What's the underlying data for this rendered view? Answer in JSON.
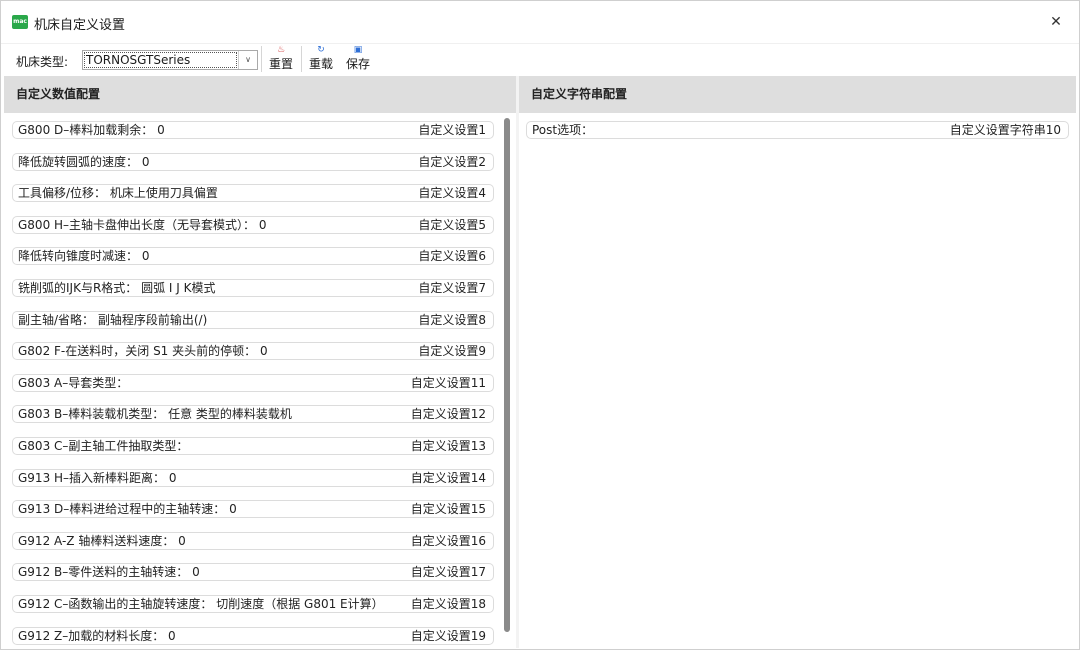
{
  "window": {
    "icon_text": "mac",
    "title": "机床自定义设置",
    "close_symbol": "✕"
  },
  "toolbar": {
    "machine_type_label": "机床类型:",
    "machine_type_value": "TORNOSGTSeries",
    "dropdown_arrow": "∨",
    "reset_label": "重置",
    "reset_icon": "♨",
    "reload_label": "重载",
    "reload_icon": "↻",
    "save_label": "保存",
    "save_icon": "▣"
  },
  "numeric_panel": {
    "header": "自定义数值配置",
    "rows": [
      {
        "label": "G800 D–棒料加载剩余：  0",
        "setting": "自定义设置1"
      },
      {
        "label": "降低旋转圆弧的速度：  0",
        "setting": "自定义设置2"
      },
      {
        "label": "工具偏移/位移：  机床上使用刀具偏置",
        "setting": "自定义设置4"
      },
      {
        "label": "G800 H–主轴卡盘伸出长度（无导套模式）：  0",
        "setting": "自定义设置5"
      },
      {
        "label": "降低转向锥度时减速：  0",
        "setting": "自定义设置6"
      },
      {
        "label": "铣削弧的IJK与R格式：  圆弧 I J K模式",
        "setting": "自定义设置7"
      },
      {
        "label": "副主轴/省略：  副轴程序段前输出(/)",
        "setting": "自定义设置8"
      },
      {
        "label": "G802 F-在送料时，关闭 S1 夹头前的停顿：  0",
        "setting": "自定义设置9"
      },
      {
        "label": "G803 A–导套类型：",
        "setting": "自定义设置11"
      },
      {
        "label": "G803 B–棒料装载机类型：  任意  类型的棒料装载机",
        "setting": "自定义设置12"
      },
      {
        "label": "G803 C–副主轴工件抽取类型：",
        "setting": "自定义设置13"
      },
      {
        "label": "G913  H–插入新棒料距离：  0",
        "setting": "自定义设置14"
      },
      {
        "label": "G913  D–棒料进给过程中的主轴转速：  0",
        "setting": "自定义设置15"
      },
      {
        "label": "G912 A-Z 轴棒料送料速度：  0",
        "setting": "自定义设置16"
      },
      {
        "label": "G912 B–零件送料的主轴转速：  0",
        "setting": "自定义设置17"
      },
      {
        "label": "G912 C–函数输出的主轴旋转速度：  切削速度（根据 G801 E计算）",
        "setting": "自定义设置18"
      },
      {
        "label": "G912 Z–加载的材料长度：  0",
        "setting": "自定义设置19"
      }
    ]
  },
  "string_panel": {
    "header": "自定义字符串配置",
    "rows": [
      {
        "label": "Post选项：",
        "setting": "自定义设置字符串10"
      }
    ]
  }
}
